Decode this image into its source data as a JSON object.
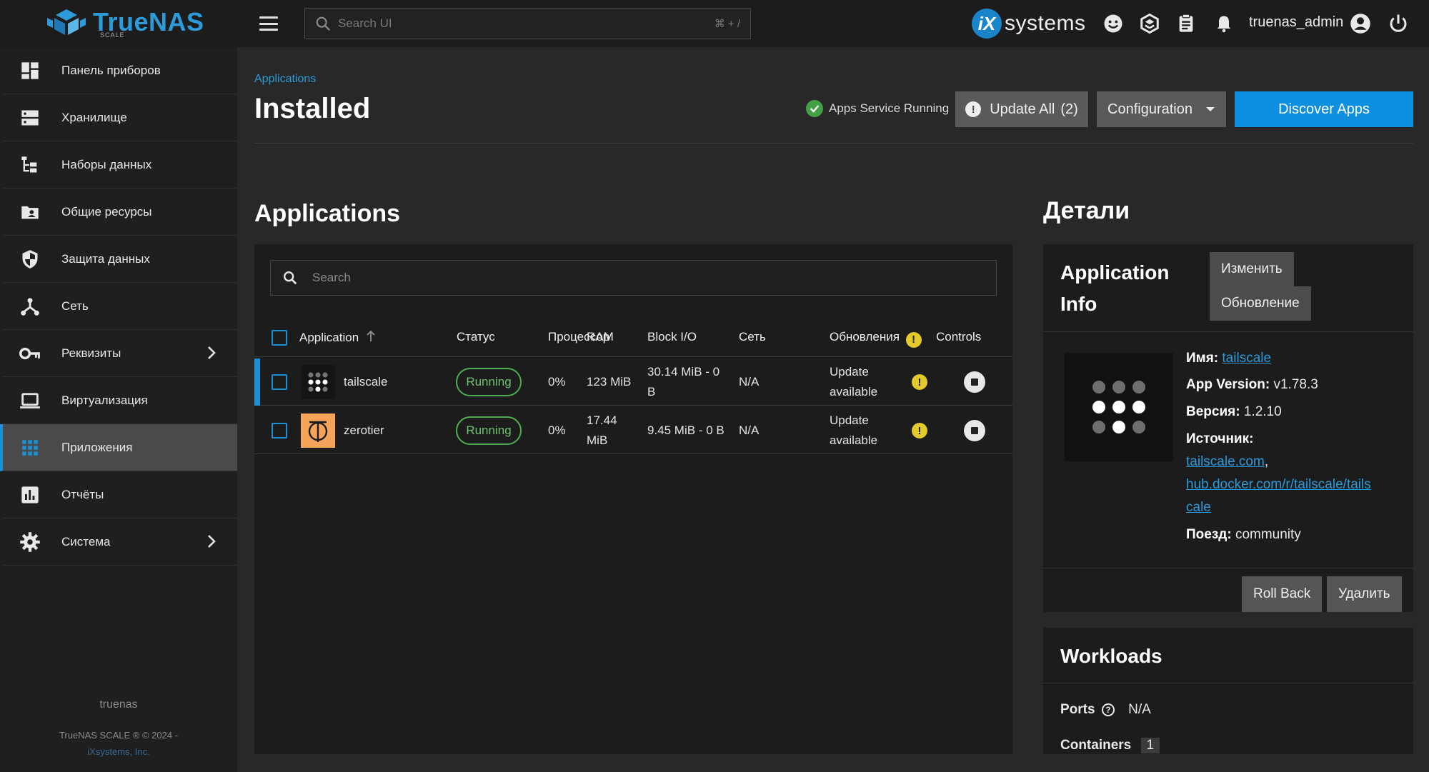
{
  "header": {
    "brand": "TrueNAS",
    "brand_sub": "SCALE",
    "search_placeholder": "Search UI",
    "search_shortcut": "⌘ + /",
    "vendor_logo_mark": "iX",
    "vendor_logo_text": "systems",
    "username": "truenas_admin",
    "icons": [
      "feedback-icon",
      "truecommand-icon",
      "jobs-clipboard-icon",
      "notifications-bell-icon",
      "user-account-icon",
      "power-icon"
    ]
  },
  "sidebar": {
    "items": [
      {
        "label": "Панель приборов",
        "icon": "dashboard-icon"
      },
      {
        "label": "Хранилище",
        "icon": "storage-icon"
      },
      {
        "label": "Наборы данных",
        "icon": "datasets-icon"
      },
      {
        "label": "Общие ресурсы",
        "icon": "shares-icon"
      },
      {
        "label": "Защита данных",
        "icon": "shield-icon"
      },
      {
        "label": "Сеть",
        "icon": "network-icon"
      },
      {
        "label": "Реквизиты",
        "icon": "key-icon"
      },
      {
        "label": "Виртуализация",
        "icon": "laptop-icon"
      },
      {
        "label": "Приложения",
        "icon": "apps-grid-icon",
        "active": true
      },
      {
        "label": "Отчёты",
        "icon": "reports-icon"
      },
      {
        "label": "Система",
        "icon": "gear-icon"
      }
    ],
    "hostname": "truenas",
    "copyright": "TrueNAS SCALE ® © 2024 -",
    "company": "iXsystems, Inc."
  },
  "page": {
    "breadcrumb": "Applications",
    "title": "Installed",
    "service_status": "Apps Service Running",
    "update_all_label": "Update All",
    "update_all_count": "(2)",
    "configuration_label": "Configuration",
    "discover_label": "Discover Apps"
  },
  "applications": {
    "section_title": "Applications",
    "search_placeholder": "Search",
    "columns": {
      "application": "Application",
      "status": "Статус",
      "cpu": "Процессор",
      "ram": "RAM",
      "block_io": "Block I/O",
      "network": "Сеть",
      "updates": "Обновления",
      "controls": "Controls"
    },
    "rows": [
      {
        "name": "tailscale",
        "status": "Running",
        "cpu": "0%",
        "ram": "123 MiB",
        "block_io_line1": "30.14 MiB - 0",
        "block_io_line2": "B",
        "network": "N/A",
        "update_line1": "Update",
        "update_line2": "available",
        "selected": true
      },
      {
        "name": "zerotier",
        "status": "Running",
        "cpu": "0%",
        "ram_line1": "17.44",
        "ram_line2": "MiB",
        "block_io": "9.45 MiB - 0 B",
        "network": "N/A",
        "update_line1": "Update",
        "update_line2": "available",
        "selected": false
      }
    ]
  },
  "details": {
    "section_title": "Детали",
    "card_title_line1": "Application",
    "card_title_line2": "Info",
    "edit_label": "Изменить",
    "update_label": "Обновление",
    "name_label": "Имя:",
    "name_value": "tailscale",
    "app_version_label": "App Version:",
    "app_version_value": "v1.78.3",
    "version_label": "Версия:",
    "version_value": "1.2.10",
    "source_label": "Источник:",
    "source_1": "tailscale.com",
    "source_sep": ",",
    "source_2_line1": "hub.docker.com/r/tailscale/tails",
    "source_2_line2": "cale",
    "train_label": "Поезд:",
    "train_value": "community",
    "rollback_label": "Roll Back",
    "delete_label": "Удалить"
  },
  "workloads": {
    "title": "Workloads",
    "ports_label": "Ports",
    "ports_value": "N/A",
    "containers_label": "Containers",
    "containers_value": "1"
  },
  "colors": {
    "accent": "#0f8fe0",
    "running": "#4caf50",
    "warning": "#e3c92b",
    "zerotier_bg": "#f5a45a"
  }
}
